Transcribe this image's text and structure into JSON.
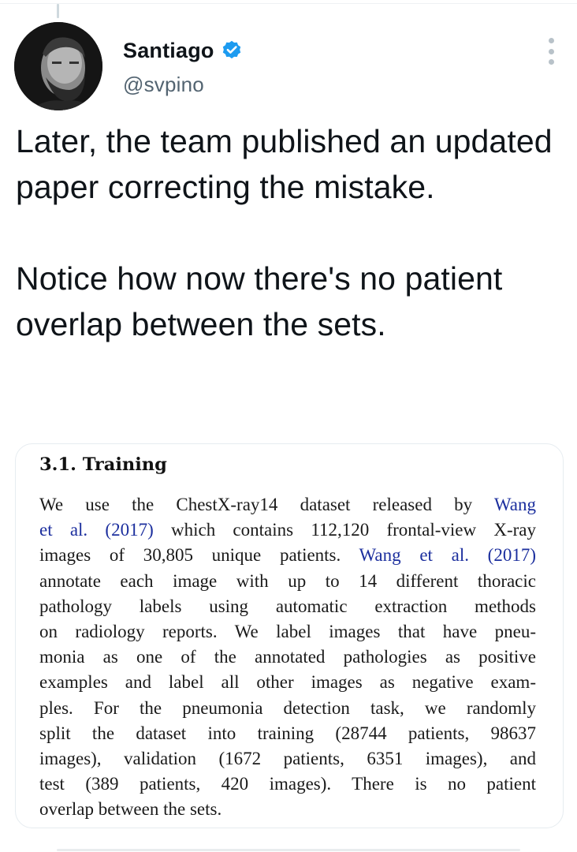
{
  "tweet": {
    "author": {
      "name": "Santiago",
      "handle": "@svpino",
      "verified": true
    },
    "text": "Later, the team published an updated paper correcting the mistake.\n\nNotice how now there's no patient overlap between the sets.",
    "icons": {
      "avatar": "avatar",
      "verified": "verified-badge-icon",
      "more": "more-options-icon"
    },
    "colors": {
      "verified_badge": "#1d9bf0",
      "handle": "#536471",
      "text": "#0f1419",
      "citation_link": "#1c2f9e"
    }
  },
  "paper_excerpt": {
    "heading": "3.1. Training",
    "lines": [
      [
        {
          "t": "We use the ChestX-ray14 dataset released by "
        },
        {
          "t": "Wang",
          "link": true
        }
      ],
      [
        {
          "t": "et al. (2017)",
          "link": true
        },
        {
          "t": " which contains 112,120 frontal-view X-ray"
        }
      ],
      [
        {
          "t": "images of 30,805 unique patients. "
        },
        {
          "t": "Wang et al. (2017)",
          "link": true
        }
      ],
      [
        {
          "t": "annotate each image with up to 14 different thoracic"
        }
      ],
      [
        {
          "t": "pathology labels using automatic extraction methods"
        }
      ],
      [
        {
          "t": "on radiology reports. We label images that have pneu-"
        }
      ],
      [
        {
          "t": "monia as one of the annotated pathologies as positive"
        }
      ],
      [
        {
          "t": "examples and label all other images as negative exam-"
        }
      ],
      [
        {
          "t": "ples. For the pneumonia detection task, we randomly"
        }
      ],
      [
        {
          "t": "split the dataset into training (28744 patients, 98637"
        }
      ],
      [
        {
          "t": "images), validation (1672 patients, 6351 images), and"
        }
      ],
      [
        {
          "t": "test (389 patients, 420 images). There is no patient"
        }
      ],
      [
        {
          "t": "overlap between the sets."
        }
      ]
    ]
  }
}
